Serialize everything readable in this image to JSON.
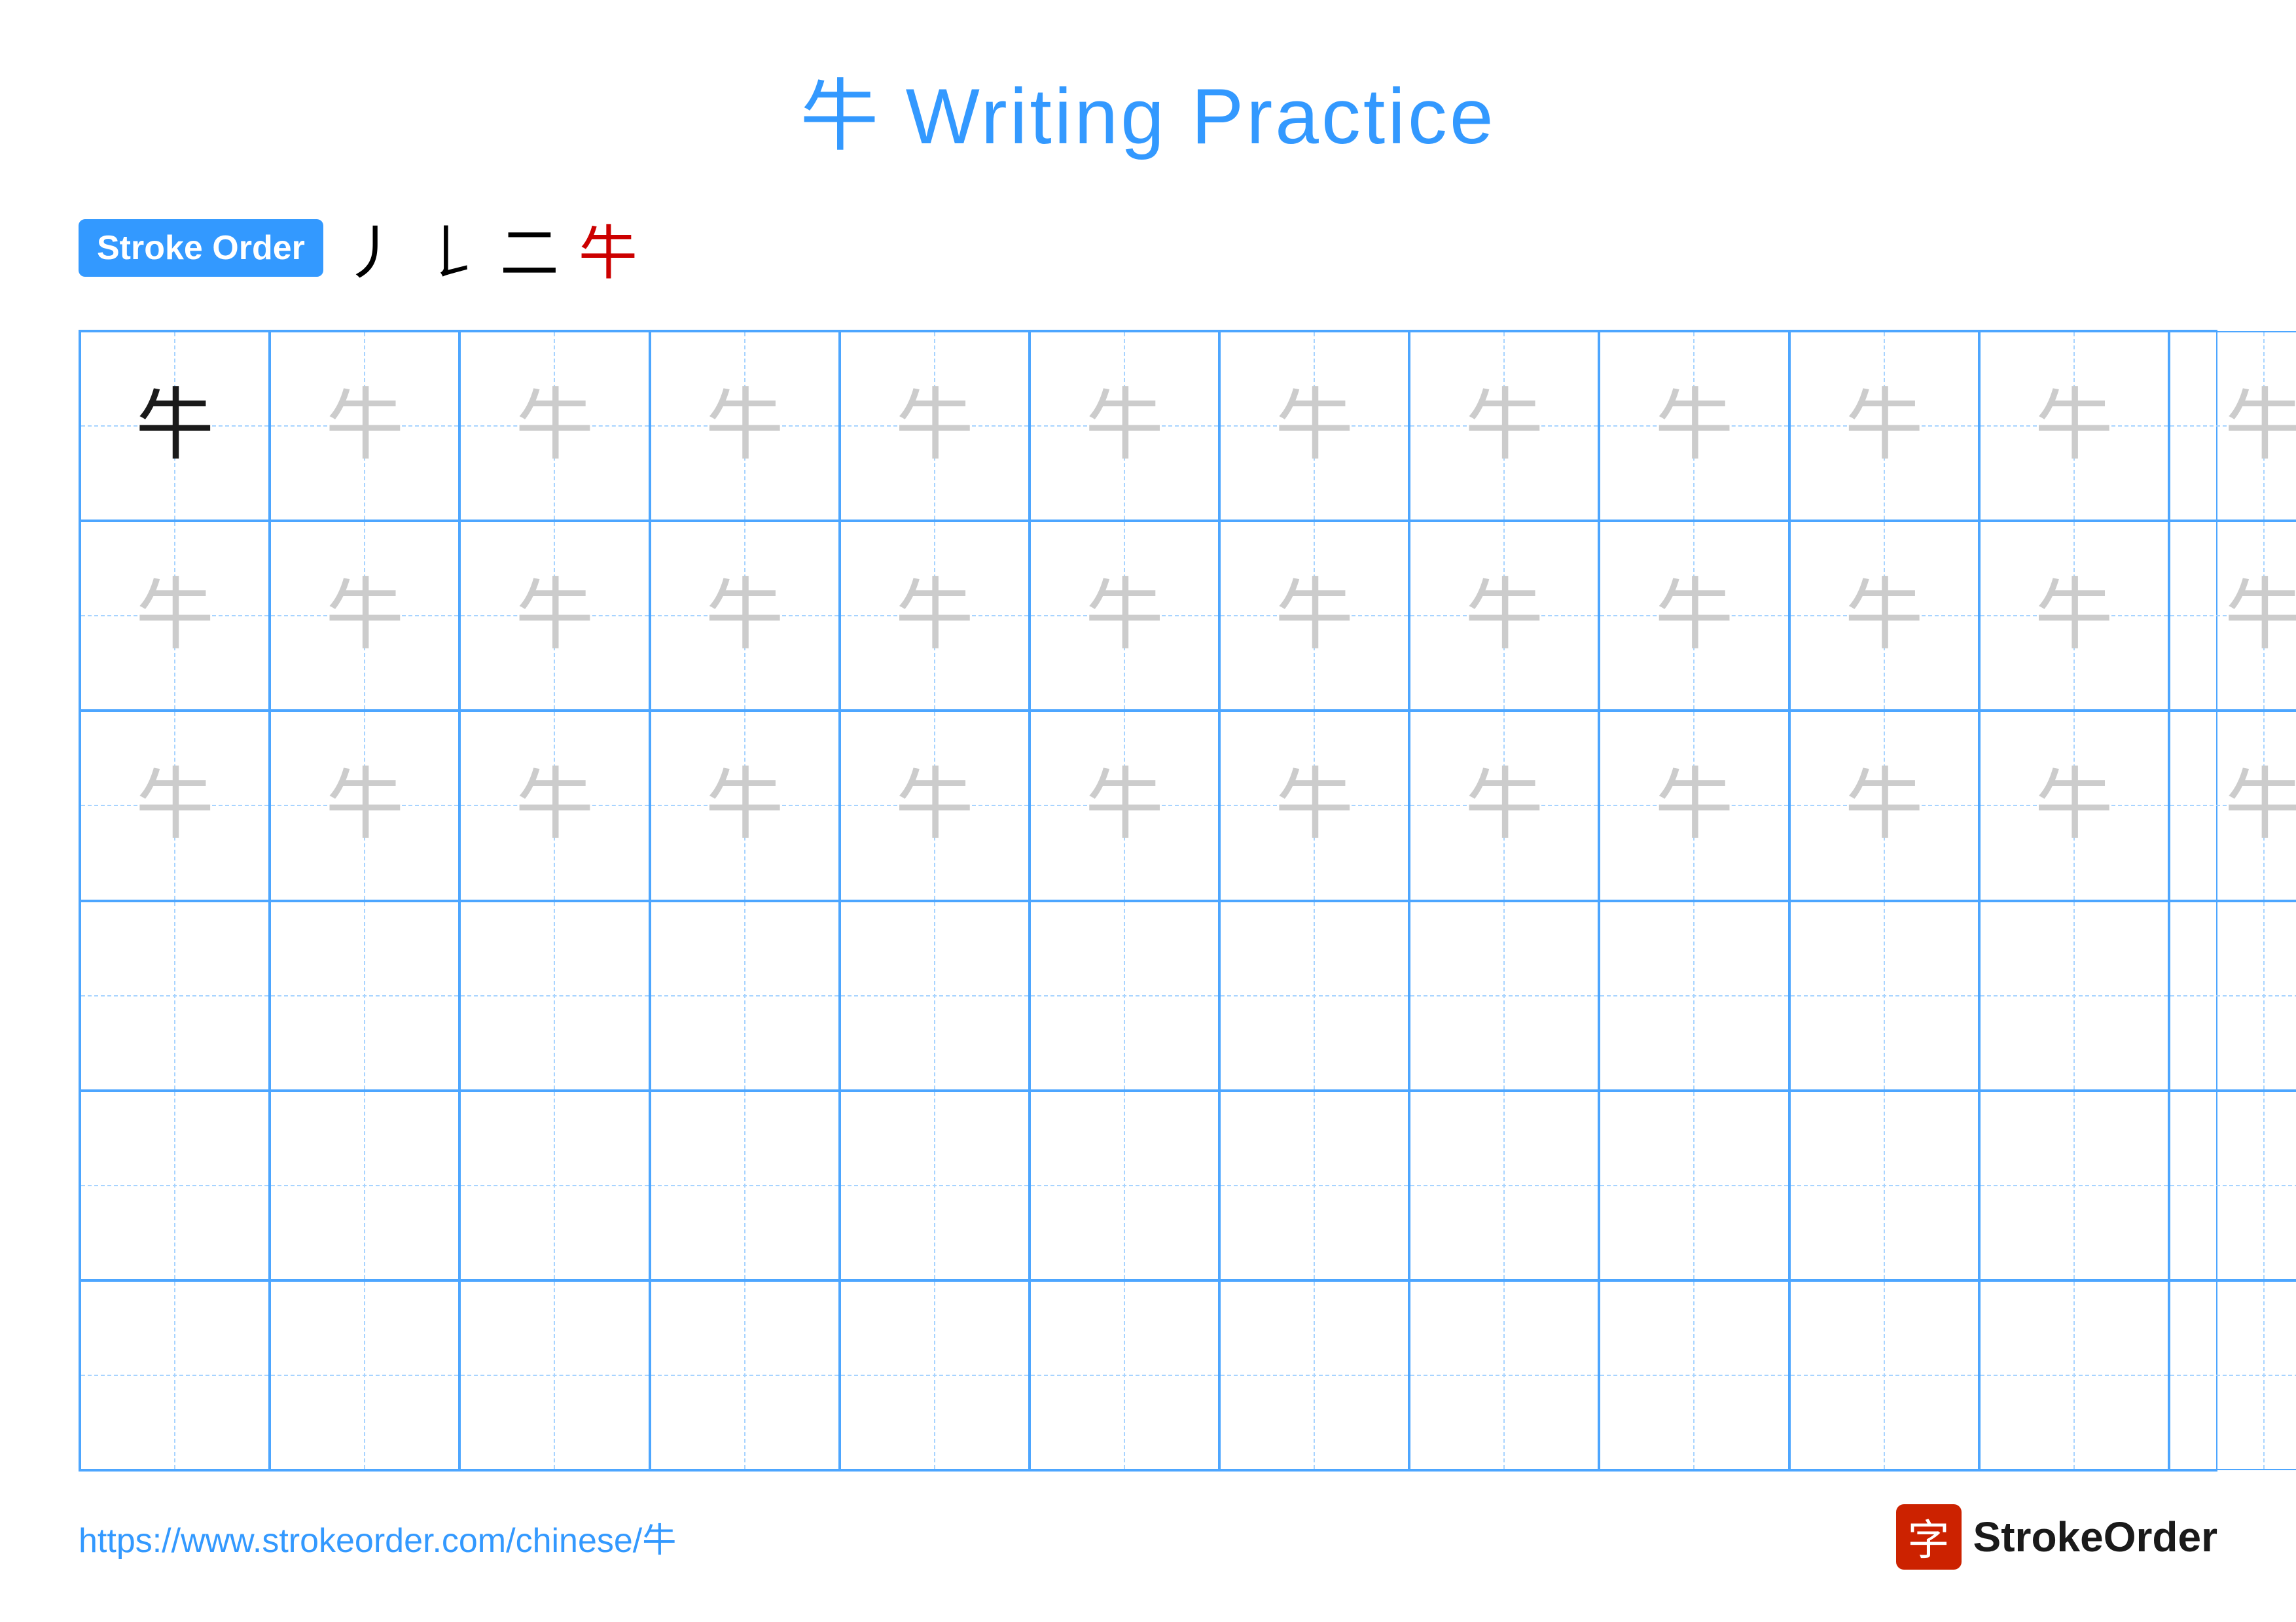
{
  "title": {
    "char": "牛",
    "rest": " Writing Practice"
  },
  "stroke_order": {
    "badge_label": "Stroke Order",
    "strokes": [
      "丿",
      "𠄌",
      "二",
      "牛"
    ]
  },
  "grid": {
    "cols": 13,
    "rows": 6,
    "char": "牛",
    "dark_row": 0,
    "dark_col": 0,
    "light_rows": [
      0,
      1,
      2
    ],
    "empty_rows": [
      3,
      4,
      5
    ]
  },
  "footer": {
    "url": "https://www.strokeorder.com/chinese/牛",
    "logo_char": "字",
    "logo_name": "StrokeOrder"
  },
  "colors": {
    "accent": "#3399ff",
    "stroke_red": "#cc2200",
    "char_dark": "#1a1a1a",
    "char_light": "#cccccc",
    "grid_border": "#4da6ff",
    "grid_dashed": "#a8d4ff"
  }
}
